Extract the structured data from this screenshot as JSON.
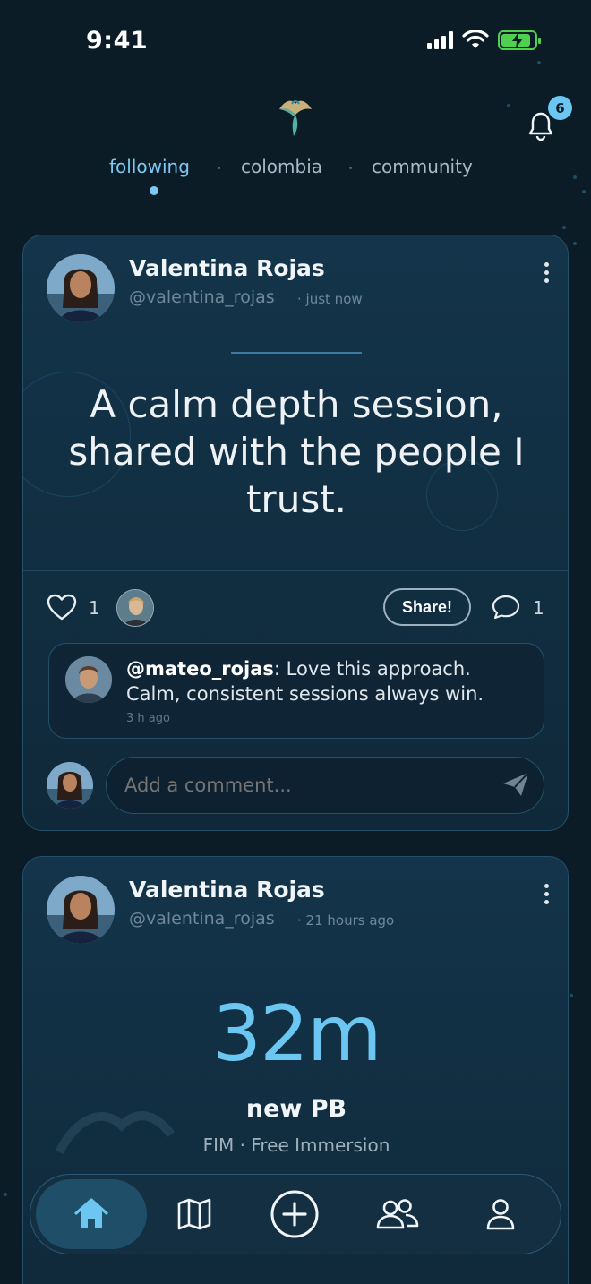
{
  "status": {
    "time": "9:41"
  },
  "header": {
    "notifications_count": "6"
  },
  "tabs": [
    {
      "label": "following",
      "active": true
    },
    {
      "label": "colombia",
      "active": false
    },
    {
      "label": "community",
      "active": false
    }
  ],
  "posts": [
    {
      "author_name": "Valentina Rojas",
      "author_handle": "@valentina_rojas",
      "time": "just now",
      "quote": "A calm depth session, shared with the people I trust.",
      "likes": "1",
      "share_label": "Share!",
      "comments_count": "1",
      "comment": {
        "author": "@mateo_rojas",
        "text": ": Love this approach. Calm, consistent sessions always win.",
        "time": "3 h ago"
      },
      "comment_placeholder": "Add a comment..."
    },
    {
      "author_name": "Valentina Rojas",
      "author_handle": "@valentina_rojas",
      "time": "21 hours ago",
      "value": "32m",
      "label": "new PB",
      "discipline": "FIM · Free Immersion"
    }
  ],
  "nav": [
    {
      "name": "home-icon",
      "active": true
    },
    {
      "name": "map-icon",
      "active": false
    },
    {
      "name": "add-icon",
      "active": false
    },
    {
      "name": "community-icon",
      "active": false
    },
    {
      "name": "profile-icon",
      "active": false
    }
  ],
  "colors": {
    "accent": "#6cc6f2",
    "background": "#0b1c27",
    "card": "#13344a"
  }
}
